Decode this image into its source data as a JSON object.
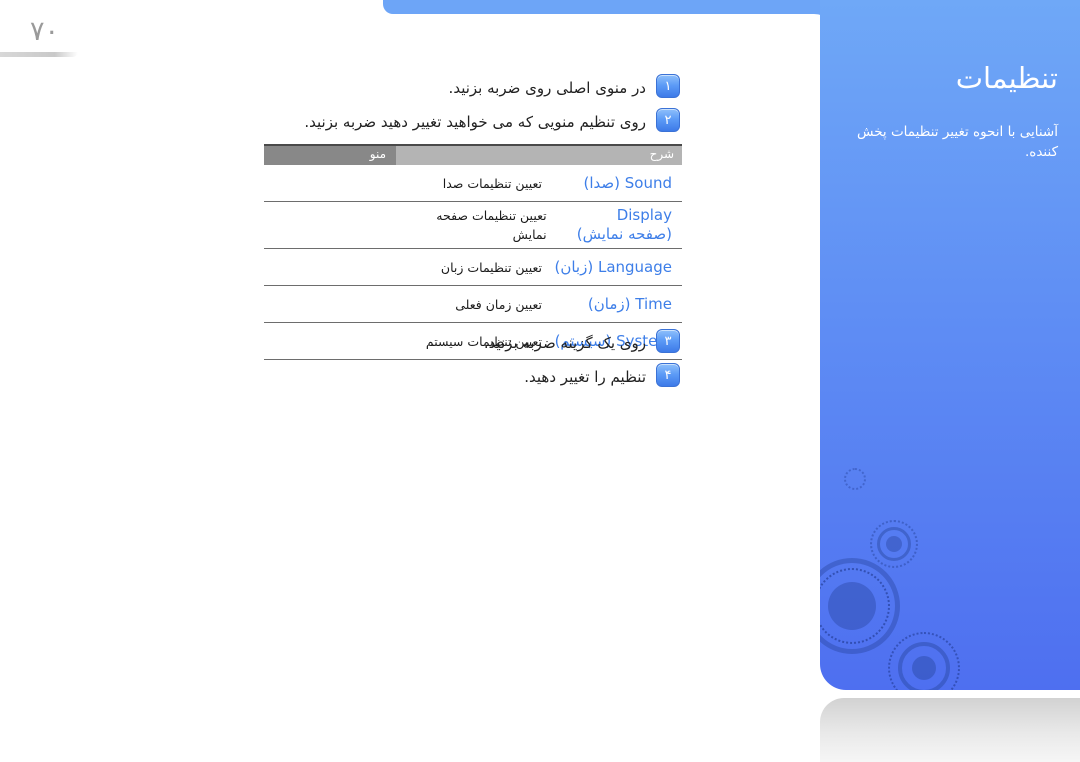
{
  "page": {
    "number": "۷۰"
  },
  "side_panel": {
    "title": "تنظیمات",
    "subtitle": "آشنایی با انحوه تغییر تنظیمات پخش کننده.",
    "accent_color": "#6fa8f7",
    "gradient_end_color": "#4e6ff0"
  },
  "steps_top": [
    {
      "badge": "۱",
      "text": "در منوی اصلی روی        ضربه بزنید."
    },
    {
      "badge": "۲",
      "text": "روی تنظیم منویی که می خواهید تغییر دهید ضربه بزنید."
    }
  ],
  "steps_bottom": [
    {
      "badge": "۳",
      "text": "روی یک گزینه ضربه بزنید."
    },
    {
      "badge": "۴",
      "text": "تنظیم را تغییر دهید."
    }
  ],
  "table": {
    "headers": {
      "menu": "منو",
      "description": "شرح"
    },
    "header_menu_bg": "#888888",
    "header_desc_bg": "#b4b4b4",
    "menu_label_color": "#3d7ee8",
    "rows": [
      {
        "menu_en": "Sound",
        "menu_fa": "(صدا)",
        "description": "تعیین تنظیمات صدا"
      },
      {
        "menu_en": "Display",
        "menu_fa": "(صفحه نمایش)",
        "description": "تعیین تنظیمات صفحه نمایش"
      },
      {
        "menu_en": "Language",
        "menu_fa": "(زبان)",
        "description": "تعیین تنظیمات زبان"
      },
      {
        "menu_en": "Time",
        "menu_fa": "(زمان)",
        "description": "تعیین زمان فعلی"
      },
      {
        "menu_en": "System",
        "menu_fa": "(سیستم)",
        "description": "تعیین تنظیمات سیستم"
      }
    ]
  }
}
